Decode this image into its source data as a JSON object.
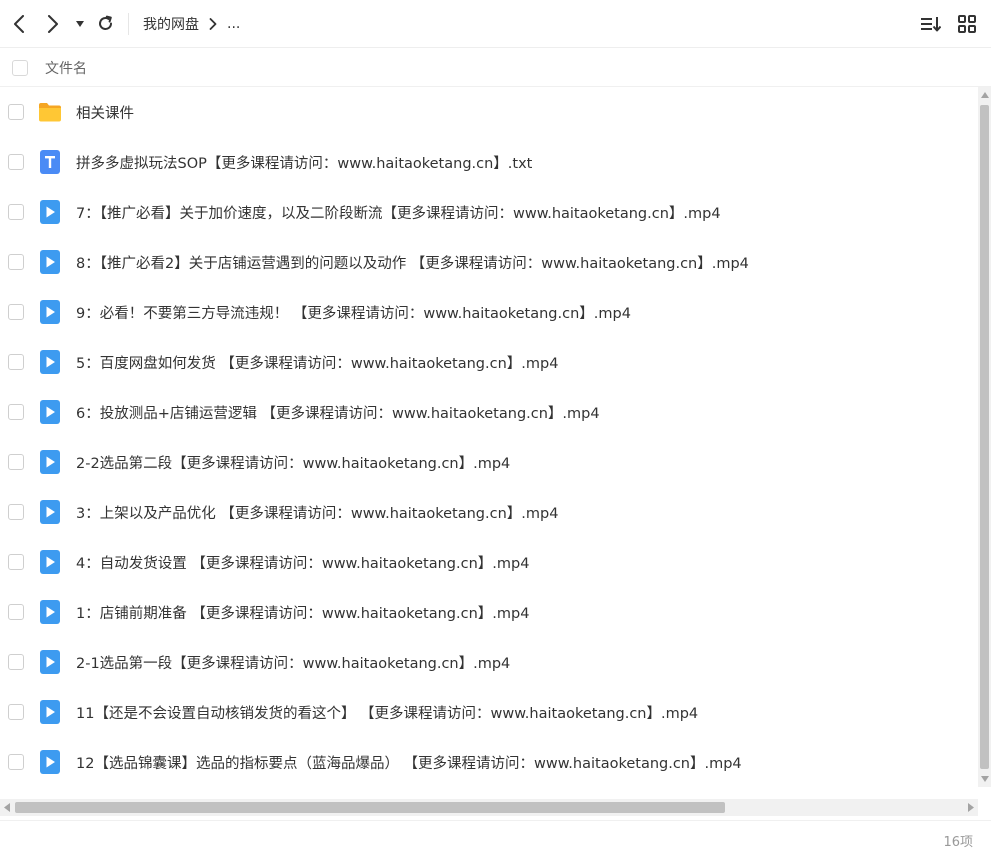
{
  "toolbar": {
    "breadcrumb": [
      "我的网盘",
      "..."
    ],
    "back_icon": "chevron-left-icon",
    "forward_icon": "chevron-right-icon",
    "history_icon": "caret-down-icon",
    "refresh_icon": "refresh-icon",
    "sort_icon": "sort-icon",
    "grid_icon": "grid-view-icon"
  },
  "header": {
    "name_column": "文件名"
  },
  "files": [
    {
      "name": "相关课件",
      "type": "folder"
    },
    {
      "name": "拼多多虚拟玩法SOP【更多课程请访问：www.haitaoketang.cn】.txt",
      "type": "txt"
    },
    {
      "name": "7：【推广必看】关于加价速度，以及二阶段断流【更多课程请访问：www.haitaoketang.cn】.mp4",
      "type": "video"
    },
    {
      "name": "8：【推广必看2】关于店铺运营遇到的问题以及动作 【更多课程请访问：www.haitaoketang.cn】.mp4",
      "type": "video"
    },
    {
      "name": "9：必看！不要第三方导流违规！ 【更多课程请访问：www.haitaoketang.cn】.mp4",
      "type": "video"
    },
    {
      "name": "5：百度网盘如何发货 【更多课程请访问：www.haitaoketang.cn】.mp4",
      "type": "video"
    },
    {
      "name": "6：投放测品+店铺运营逻辑 【更多课程请访问：www.haitaoketang.cn】.mp4",
      "type": "video"
    },
    {
      "name": "2-2选品第二段【更多课程请访问：www.haitaoketang.cn】.mp4",
      "type": "video"
    },
    {
      "name": "3：上架以及产品优化 【更多课程请访问：www.haitaoketang.cn】.mp4",
      "type": "video"
    },
    {
      "name": "4：自动发货设置 【更多课程请访问：www.haitaoketang.cn】.mp4",
      "type": "video"
    },
    {
      "name": "1：店铺前期准备 【更多课程请访问：www.haitaoketang.cn】.mp4",
      "type": "video"
    },
    {
      "name": "2-1选品第一段【更多课程请访问：www.haitaoketang.cn】.mp4",
      "type": "video"
    },
    {
      "name": "11【还是不会设置自动核销发货的看这个】 【更多课程请访问：www.haitaoketang.cn】.mp4",
      "type": "video"
    },
    {
      "name": "12【选品锦囊课】选品的指标要点（蓝海品爆品） 【更多课程请访问：www.haitaoketang.cn】.mp4",
      "type": "video"
    }
  ],
  "status": {
    "count": "16项"
  },
  "colors": {
    "folder": "#FFC734",
    "folder_tab": "#F5A623",
    "txt_icon": "#4A8BF5",
    "video_icon": "#3D9BF0",
    "icon_glyph": "#ffffff"
  }
}
